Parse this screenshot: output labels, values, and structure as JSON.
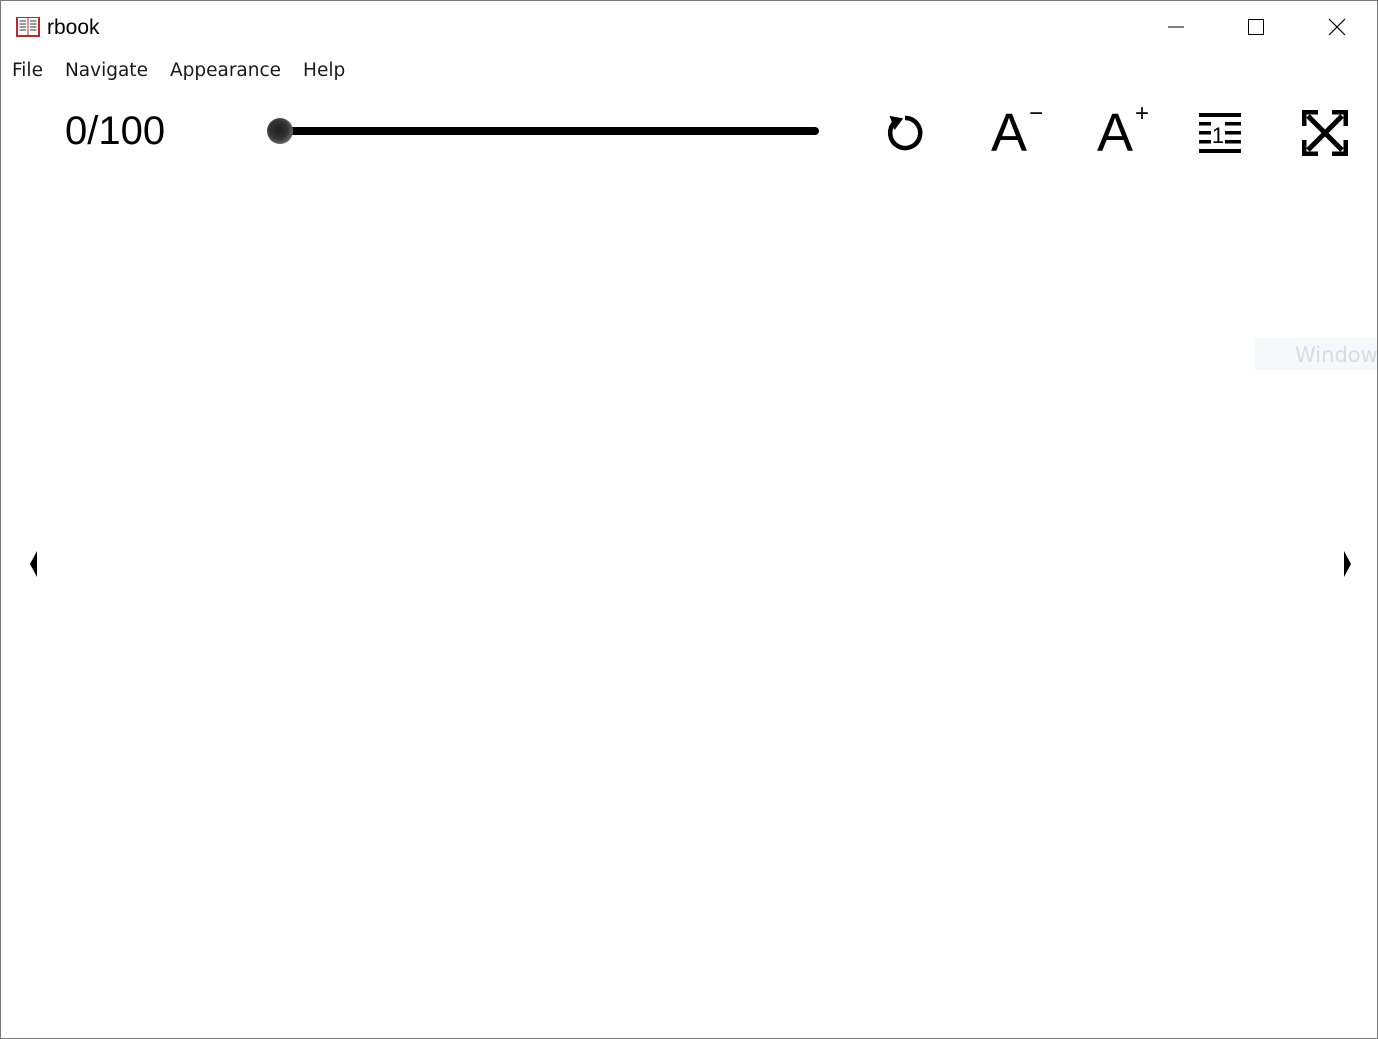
{
  "window": {
    "title": "rbook",
    "controls": [
      "minimize",
      "maximize",
      "close"
    ]
  },
  "menubar": {
    "items": [
      {
        "label": "File"
      },
      {
        "label": "Navigate"
      },
      {
        "label": "Appearance"
      },
      {
        "label": "Help"
      }
    ]
  },
  "toolbar": {
    "page_counter": "0/100",
    "progress": {
      "current": 0,
      "max": 100
    },
    "buttons": [
      {
        "name": "reload-button",
        "icon": "reload-icon"
      },
      {
        "name": "decrease-font-button",
        "icon": "font-decrease-icon",
        "letter": "A",
        "sign": "−"
      },
      {
        "name": "increase-font-button",
        "icon": "font-increase-icon",
        "letter": "A",
        "sign": "+"
      },
      {
        "name": "line-spacing-button",
        "icon": "line-spacing-icon",
        "digit": "1"
      },
      {
        "name": "fullscreen-button",
        "icon": "fullscreen-icon"
      }
    ]
  },
  "content": {
    "watermark_text": "Window",
    "prev_page_icon": "triangle-left-icon",
    "next_page_icon": "triangle-right-icon"
  }
}
